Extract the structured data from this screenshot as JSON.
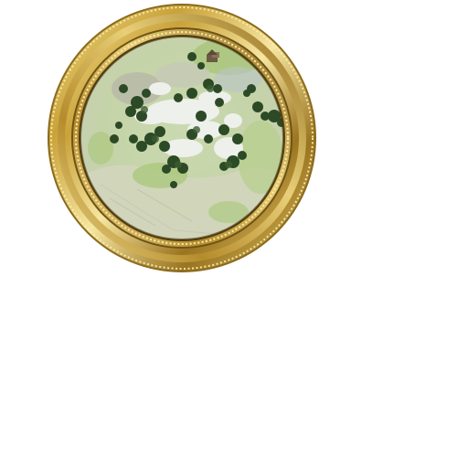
{
  "minimap": {
    "frame_style": "ornate gilded round frame",
    "terrain_style": "top-down rendered landscape",
    "colors": {
      "frame_gold": "#c9a43d",
      "frame_dark": "#7a5a14",
      "frame_light": "#f4e08a",
      "meadow": "#c4d6a4",
      "grass": "#a9c97a",
      "field": "#d3d6bc",
      "rock": "#e9ece8",
      "forest": "#2c4a26",
      "water": "#b8c4c9"
    },
    "icons": {
      "frame": "gold-ring-frame-icon",
      "village": "village-icon"
    }
  }
}
